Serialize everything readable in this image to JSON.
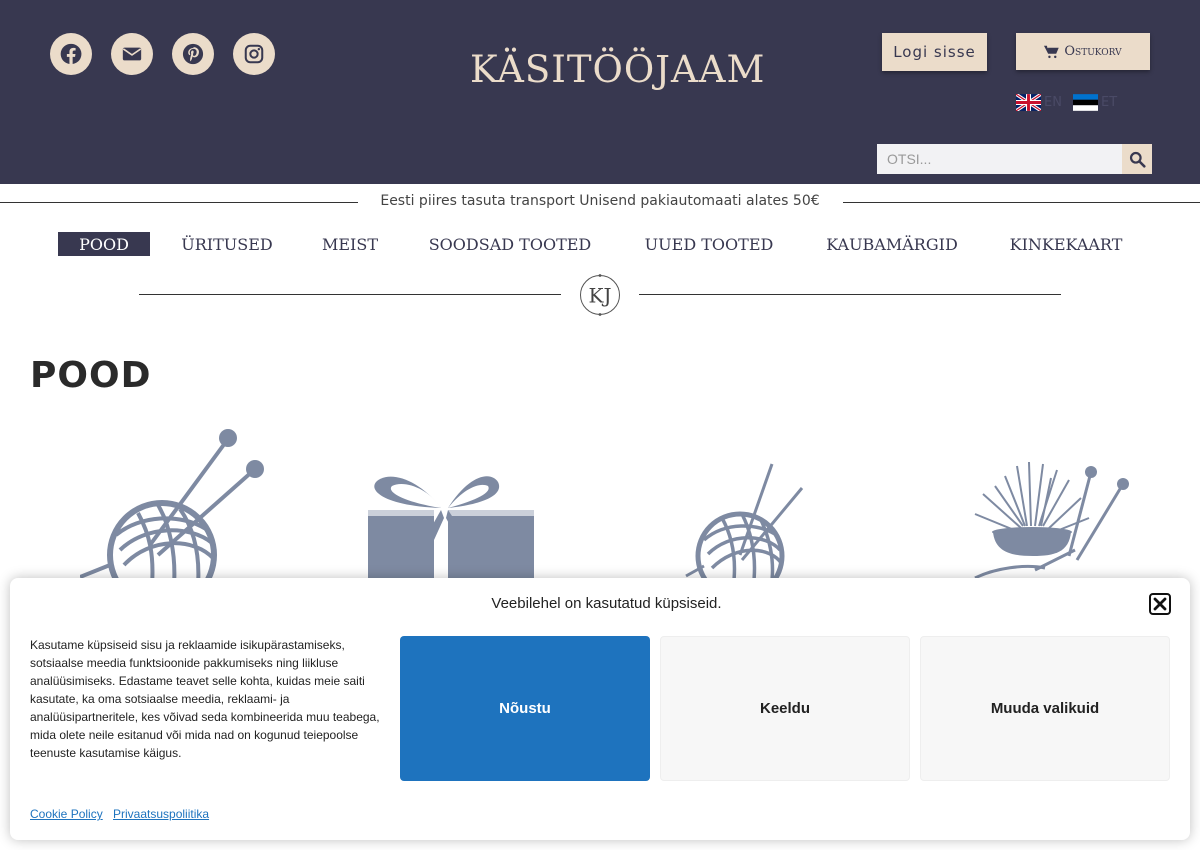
{
  "colors": {
    "header_bg": "#383850",
    "accent_beige": "#ebdcca",
    "icon_slate": "#7e8aa2",
    "accept_blue": "#1e73be"
  },
  "header": {
    "logo_text": "KÄSITÖÖJAAM",
    "social_icons": [
      "facebook-icon",
      "email-icon",
      "pinterest-icon",
      "instagram-icon"
    ],
    "login_label": "Logi sisse",
    "cart_label": "Ostukorv",
    "languages": [
      {
        "code": "EN",
        "icon": "flag-uk-icon"
      },
      {
        "code": "ET",
        "icon": "flag-estonia-icon"
      }
    ],
    "search": {
      "placeholder": "OTSI...",
      "value": ""
    }
  },
  "shipping_notice": "Eesti piires tasuta transport Unisend pakiautomaati alates 50€",
  "nav": {
    "items": [
      {
        "label": "POOD",
        "active": true
      },
      {
        "label": "ÜRITUSED"
      },
      {
        "label": "MEIST"
      },
      {
        "label": "SOODSAD TOOTED"
      },
      {
        "label": "UUED TOOTED"
      },
      {
        "label": "KAUBAMÄRGID"
      },
      {
        "label": "KINKEKAART"
      }
    ],
    "divider_monogram": "KJ"
  },
  "page_title": "POOD",
  "categories": [
    {
      "icon": "yarn-ball-needles-icon"
    },
    {
      "icon": "gift-box-icon"
    },
    {
      "icon": "yarn-ball-needles-icon"
    },
    {
      "icon": "pincushion-icon"
    }
  ],
  "cookie_banner": {
    "title": "Veebilehel on kasutatud küpsiseid.",
    "body": "Kasutame küpsiseid sisu ja reklaamide isikupärastamiseks, sotsiaalse meedia funktsioonide pakkumiseks ning liikluse analüüsimiseks. Edastame teavet selle kohta, kuidas meie saiti kasutate, ka oma sotsiaalse meedia, reklaami- ja analüüsipartneritele, kes võivad seda kombineerida muu teabega, mida olete neile esitanud või mida nad on kogunud teiepoolse teenuste kasutamise käigus.",
    "accept_label": "Nõustu",
    "deny_label": "Keeldu",
    "preferences_label": "Muuda valikuid",
    "links": [
      "Cookie Policy",
      "Privaatsuspoliitika"
    ]
  }
}
